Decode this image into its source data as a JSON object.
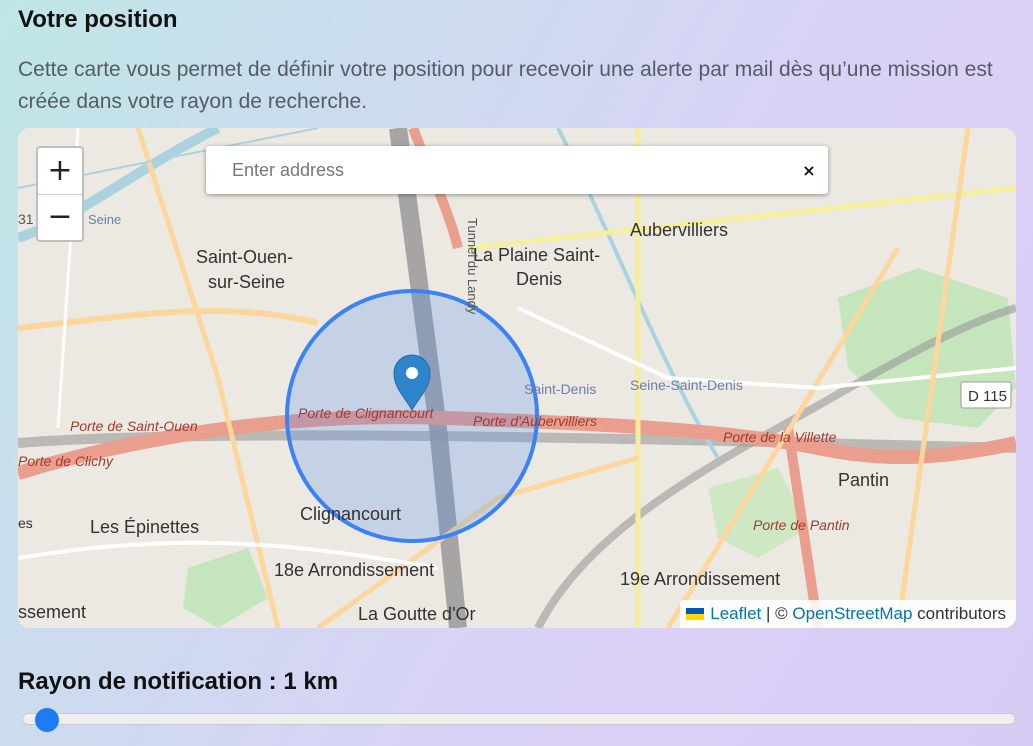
{
  "section": {
    "title": "Votre position",
    "description": "Cette carte vous permet de définir votre position pour recevoir une alerte par mail dès qu’une mission est créée dans votre rayon de recherche."
  },
  "map": {
    "zoom_in": "+",
    "zoom_out": "−",
    "search_placeholder": "Enter address",
    "clear_symbol": "×",
    "attribution": {
      "leaflet": "Leaflet",
      "sep": "| ©",
      "osm": "OpenStreetMap",
      "contributors": "contributors"
    },
    "labels": {
      "saint_ouen_1": "Saint-Ouen-",
      "saint_ouen_2": "sur-Seine",
      "plaine_1": "La Plaine Saint-",
      "plaine_2": "Denis",
      "aubervilliers": "Aubervilliers",
      "pantin": "Pantin",
      "les_epinettes": "Les Épinettes",
      "clignancourt": "Clignancourt",
      "arr18": "18e Arrondissement",
      "arr19": "19e Arrondissement",
      "goutte": "La Goutte d'Or",
      "porte_clignancourt": "Porte de Clignancourt",
      "porte_aubervilliers": "Porte d'Aubervilliers",
      "porte_saint_ouen": "Porte de Saint-Ouen",
      "porte_clichy": "Porte de Clichy",
      "porte_villette": "Porte de la Villette",
      "porte_pantin": "Porte de Pantin",
      "saint_denis_canal": "Saint-Denis",
      "seine_saint_denis": "Seine-Saint-Denis",
      "d115": "D 115",
      "tunnel": "Tunnel du Landy",
      "road_31": "31",
      "seine": "Seine",
      "semant": "ssement",
      "es": "es"
    }
  },
  "radius": {
    "label": "Rayon de notification : 1 km",
    "value_km": 1,
    "fraction": 0.013
  },
  "colors": {
    "circle": "#3b82f6",
    "marker": "#2f84cc",
    "slider_thumb": "#1e7cf2",
    "link": "#0078a8"
  }
}
